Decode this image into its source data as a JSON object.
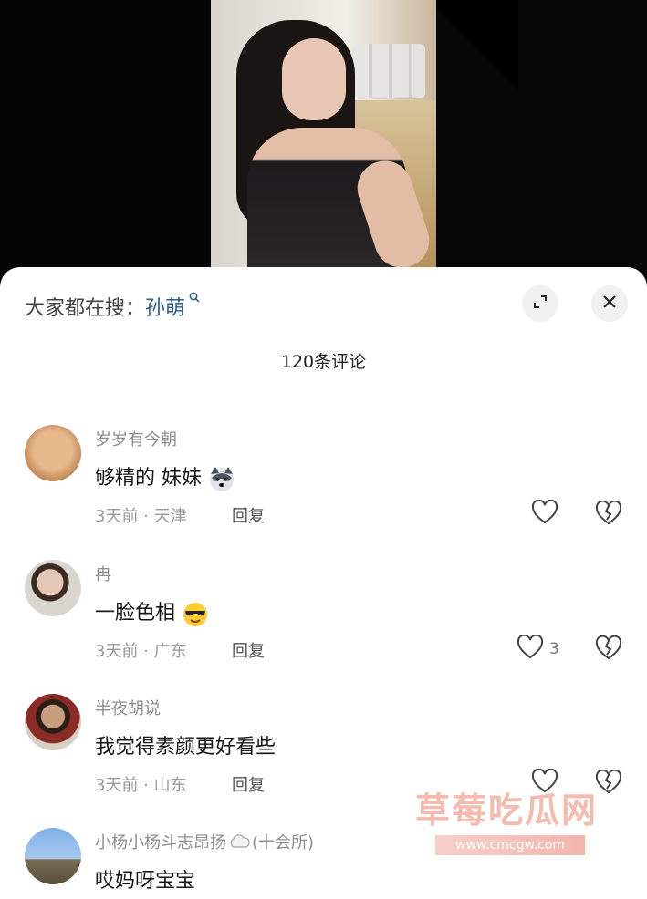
{
  "search_hint": {
    "prefix": "大家都在搜：",
    "keyword": "孙萌"
  },
  "icons": {
    "expand": "expand-icon",
    "close": "close-icon",
    "like": "heart-outline-icon",
    "dislike": "broken-heart-icon"
  },
  "comment_count": "120条评论",
  "comments": [
    {
      "username": "岁岁有今朝",
      "text": "够精的 妹妹",
      "emoji": "husky-emoji",
      "time": "3天前",
      "location": "天津",
      "reply": "回复",
      "likes": ""
    },
    {
      "username": "冉",
      "text": "一脸色相",
      "emoji": "sunglasses-emoji",
      "time": "3天前",
      "location": "广东",
      "reply": "回复",
      "likes": "3"
    },
    {
      "username": "半夜胡说",
      "text": "我觉得素颜更好看些",
      "emoji": "",
      "time": "3天前",
      "location": "山东",
      "reply": "回复",
      "likes": ""
    },
    {
      "username": "小杨小杨斗志昂扬",
      "badge": "(十会所)",
      "text": "哎妈呀宝宝",
      "emoji": "",
      "time": "",
      "location": "",
      "reply": "",
      "likes": ""
    }
  ],
  "meta_separator": " · ",
  "watermark": {
    "title": "草莓吃瓜网",
    "url": "www.cmcgw.com"
  }
}
